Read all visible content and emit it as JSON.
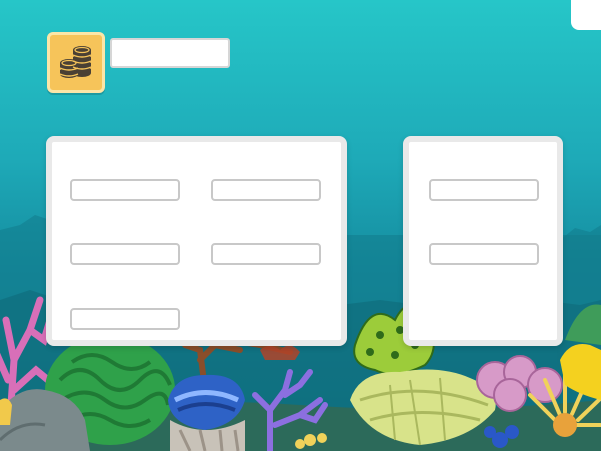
{
  "hud": {
    "coin_icon": "coin-stack-icon",
    "coin_value": ""
  },
  "panels": {
    "left": {
      "slots": [
        "",
        "",
        "",
        "",
        ""
      ]
    },
    "right": {
      "slots": [
        "",
        ""
      ]
    }
  },
  "colors": {
    "water_top": "#26c6c8",
    "water_bottom": "#0f6f82",
    "coin_tile": "#f6c45a",
    "panel_bg": "#ffffff",
    "panel_border": "#e9e9e9",
    "slot_border": "#c8c8c8"
  }
}
